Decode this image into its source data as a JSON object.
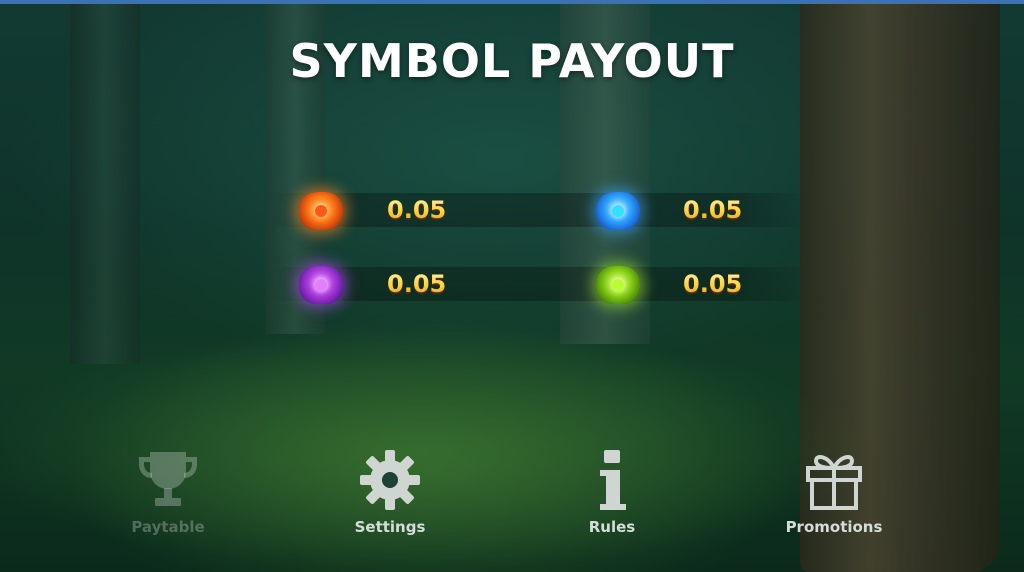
{
  "header": {
    "title": "SYMBOL PAYOUT"
  },
  "symbols": [
    {
      "name": "orange-gem",
      "color": "#ff7a18",
      "payout": "0.05"
    },
    {
      "name": "blue-gem",
      "color": "#2fa8ff",
      "payout": "0.05"
    },
    {
      "name": "purple-gem",
      "color": "#b040e0",
      "payout": "0.05"
    },
    {
      "name": "green-gem",
      "color": "#8ed61a",
      "payout": "0.05"
    }
  ],
  "nav": {
    "items": [
      {
        "label": "Paytable",
        "icon": "trophy-icon",
        "state": "inactive"
      },
      {
        "label": "Settings",
        "icon": "gear-icon",
        "state": "active"
      },
      {
        "label": "Rules",
        "icon": "info-icon",
        "state": "active"
      },
      {
        "label": "Promotions",
        "icon": "gift-icon",
        "state": "active"
      }
    ]
  },
  "colors": {
    "accent_bar": "#3a72b8",
    "payout_gold": "#ffd54a",
    "title_text": "#ffffff"
  }
}
